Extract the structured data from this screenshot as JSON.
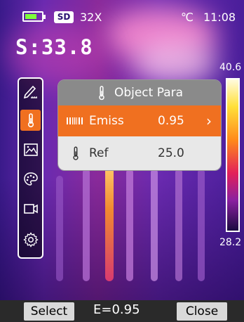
{
  "status": {
    "sd_label": "SD",
    "zoom": "32X",
    "temp_unit": "℃",
    "time": "11:08",
    "battery_color": "#7dff3a"
  },
  "spot_reading": "S:33.8",
  "scale": {
    "max": "40.6",
    "min": "28.2"
  },
  "menu": {
    "items": [
      {
        "icon": "pen-icon",
        "selected": false
      },
      {
        "icon": "thermometer-icon",
        "selected": true
      },
      {
        "icon": "image-icon",
        "selected": false
      },
      {
        "icon": "palette-icon",
        "selected": false
      },
      {
        "icon": "video-camera-icon",
        "selected": false
      },
      {
        "icon": "gear-icon",
        "selected": false
      }
    ]
  },
  "popup": {
    "title": "Object Para",
    "rows": [
      {
        "label": "Emiss",
        "value": "0.95",
        "icon": "emissivity-icon",
        "selected": true
      },
      {
        "label": "Ref",
        "value": "25.0",
        "icon": "thermometer-icon",
        "selected": false
      }
    ]
  },
  "bottom": {
    "select_label": "Select",
    "emissivity_readout": "E=0.95",
    "close_label": "Close"
  },
  "colors": {
    "accent": "#f07020",
    "header_gray": "#8a8a8a"
  }
}
